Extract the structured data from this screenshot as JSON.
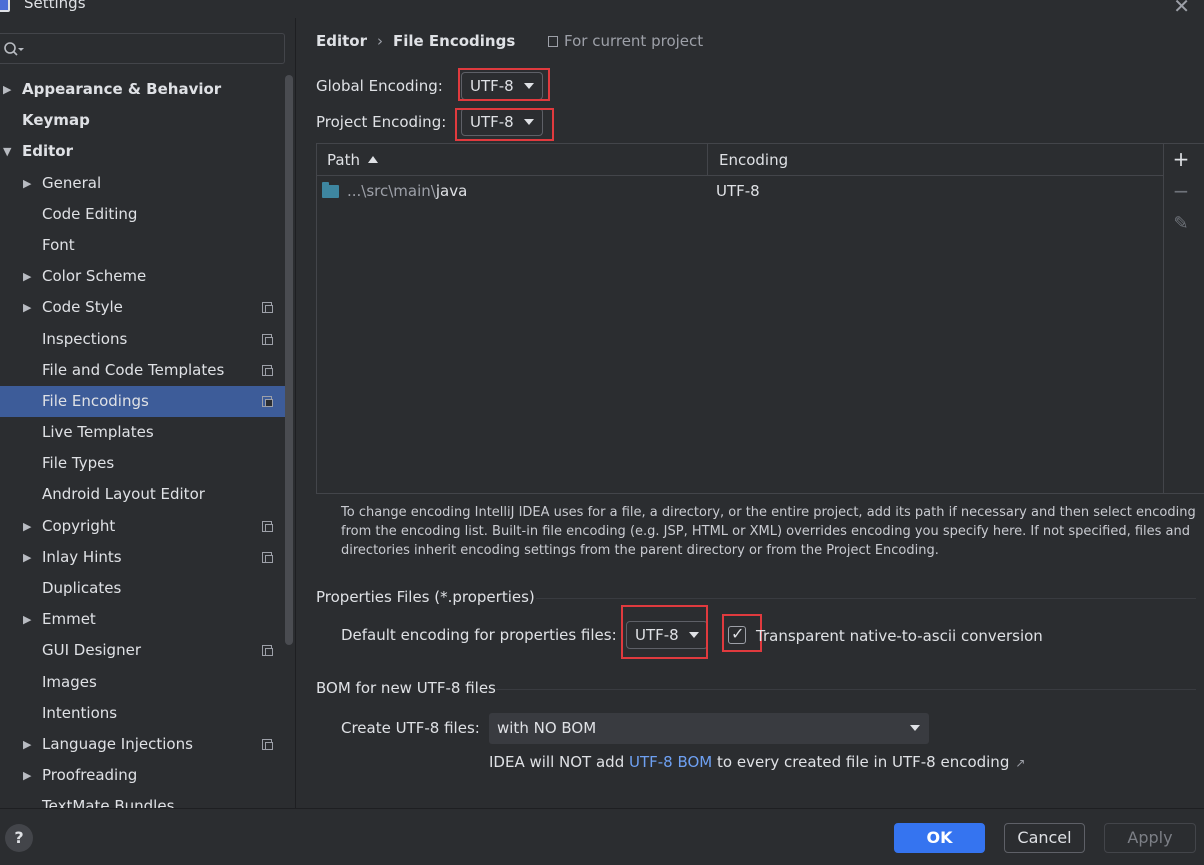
{
  "window": {
    "title": "Settings"
  },
  "sidebar": {
    "items": [
      {
        "label": "Appearance & Behavior",
        "level": 0,
        "arrow": "right",
        "bold": true,
        "project": false
      },
      {
        "label": "Keymap",
        "level": 0,
        "arrow": "none",
        "bold": true,
        "project": false
      },
      {
        "label": "Editor",
        "level": 0,
        "arrow": "down",
        "bold": true,
        "project": false
      },
      {
        "label": "General",
        "level": 1,
        "arrow": "right",
        "bold": false,
        "project": false
      },
      {
        "label": "Code Editing",
        "level": 1,
        "arrow": "none",
        "bold": false,
        "project": false
      },
      {
        "label": "Font",
        "level": 1,
        "arrow": "none",
        "bold": false,
        "project": false
      },
      {
        "label": "Color Scheme",
        "level": 1,
        "arrow": "right",
        "bold": false,
        "project": false
      },
      {
        "label": "Code Style",
        "level": 1,
        "arrow": "right",
        "bold": false,
        "project": true
      },
      {
        "label": "Inspections",
        "level": 1,
        "arrow": "none",
        "bold": false,
        "project": true
      },
      {
        "label": "File and Code Templates",
        "level": 1,
        "arrow": "none",
        "bold": false,
        "project": true
      },
      {
        "label": "File Encodings",
        "level": 1,
        "arrow": "none",
        "bold": false,
        "project": true,
        "selected": true
      },
      {
        "label": "Live Templates",
        "level": 1,
        "arrow": "none",
        "bold": false,
        "project": false
      },
      {
        "label": "File Types",
        "level": 1,
        "arrow": "none",
        "bold": false,
        "project": false
      },
      {
        "label": "Android Layout Editor",
        "level": 1,
        "arrow": "none",
        "bold": false,
        "project": false
      },
      {
        "label": "Copyright",
        "level": 1,
        "arrow": "right",
        "bold": false,
        "project": true
      },
      {
        "label": "Inlay Hints",
        "level": 1,
        "arrow": "right",
        "bold": false,
        "project": true
      },
      {
        "label": "Duplicates",
        "level": 1,
        "arrow": "none",
        "bold": false,
        "project": false
      },
      {
        "label": "Emmet",
        "level": 1,
        "arrow": "right",
        "bold": false,
        "project": false
      },
      {
        "label": "GUI Designer",
        "level": 1,
        "arrow": "none",
        "bold": false,
        "project": true
      },
      {
        "label": "Images",
        "level": 1,
        "arrow": "none",
        "bold": false,
        "project": false
      },
      {
        "label": "Intentions",
        "level": 1,
        "arrow": "none",
        "bold": false,
        "project": false
      },
      {
        "label": "Language Injections",
        "level": 1,
        "arrow": "right",
        "bold": false,
        "project": true
      },
      {
        "label": "Proofreading",
        "level": 1,
        "arrow": "right",
        "bold": false,
        "project": false
      },
      {
        "label": "TextMate Bundles",
        "level": 1,
        "arrow": "none",
        "bold": false,
        "project": false
      }
    ]
  },
  "header": {
    "breadcrumb_parent": "Editor",
    "breadcrumb_current": "File Encodings",
    "for_current_project": "For current project"
  },
  "encoding": {
    "global_label": "Global Encoding:",
    "global_value": "UTF-8",
    "project_label": "Project Encoding:",
    "project_value": "UTF-8"
  },
  "table": {
    "columns": [
      "Path",
      "Encoding"
    ],
    "rows": [
      {
        "path_prefix": "...\\src\\main\\",
        "path_name": "java",
        "encoding": "UTF-8"
      }
    ],
    "add_icon": "+",
    "remove_icon": "−",
    "edit_icon": "✎"
  },
  "help_text": "To change encoding IntelliJ IDEA uses for a file, a directory, or the entire project, add its path if necessary and then select encoding from the encoding list. Built-in file encoding (e.g. JSP, HTML or XML) overrides encoding you specify here. If not specified, files and directories inherit encoding settings from the parent directory or from the Project Encoding.",
  "properties": {
    "section_title": "Properties Files (*.properties)",
    "default_label": "Default encoding for properties files:",
    "default_value": "UTF-8",
    "native_to_ascii_label": "Transparent native-to-ascii conversion",
    "native_to_ascii_checked": true
  },
  "bom": {
    "section_title": "BOM for new UTF-8 files",
    "create_label": "Create UTF-8 files:",
    "create_value": "with NO BOM",
    "note_before": "IDEA will NOT add ",
    "note_link": "UTF-8 BOM",
    "note_after": " to every created file in UTF-8 encoding",
    "note_ext_icon": "↗"
  },
  "footer": {
    "help": "?",
    "ok": "OK",
    "cancel": "Cancel",
    "apply": "Apply"
  },
  "colors": {
    "background": "#2b2d30",
    "selection": "#3d5c99",
    "accent": "#3574f0",
    "highlight_box": "#e03a3e",
    "link": "#6ea0f2",
    "folder": "#3e86a0"
  }
}
